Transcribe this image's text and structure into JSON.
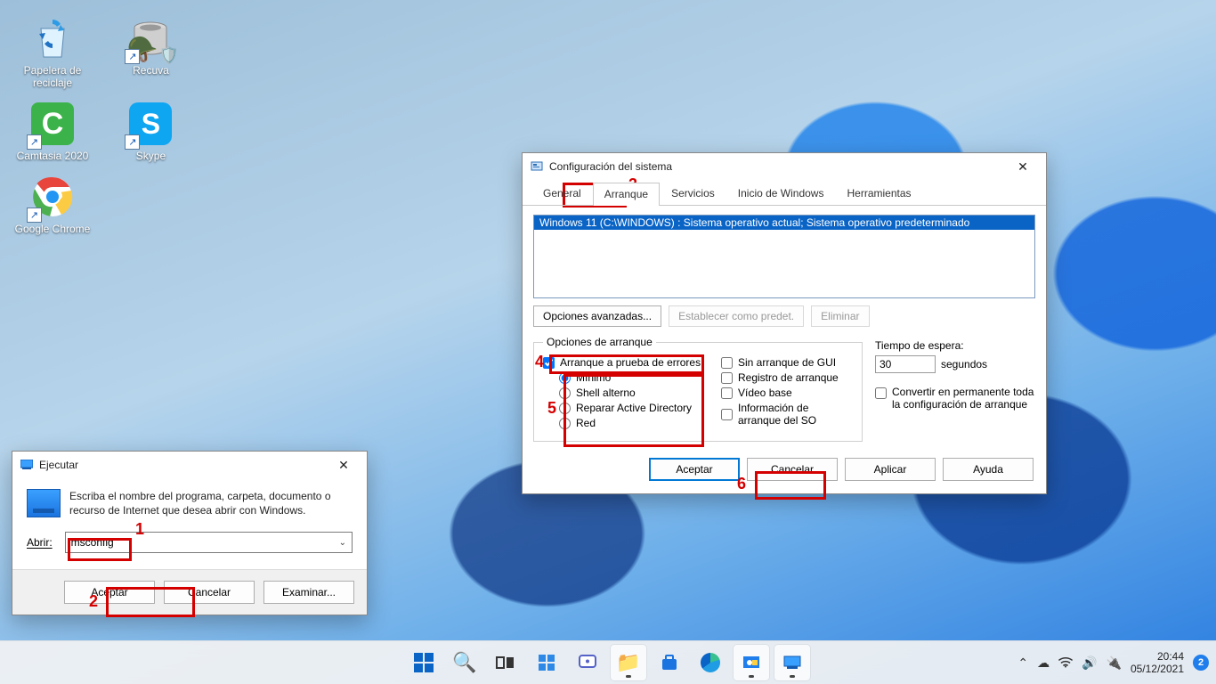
{
  "desktop": {
    "icons": [
      {
        "name": "Papelera de reciclaje",
        "glyph": "recycle-bin"
      },
      {
        "name": "Recuva",
        "glyph": "recuva",
        "shortcut": true,
        "shield": true
      },
      {
        "name": "Camtasia 2020",
        "glyph": "camtasia",
        "shortcut": true
      },
      {
        "name": "Skype",
        "glyph": "skype",
        "shortcut": true
      },
      {
        "name": "Google Chrome",
        "glyph": "chrome",
        "shortcut": true
      }
    ]
  },
  "run_dialog": {
    "title": "Ejecutar",
    "description": "Escriba el nombre del programa, carpeta, documento o recurso de Internet que desea abrir con Windows.",
    "open_label": "Abrir:",
    "open_value": "msconfig",
    "buttons": {
      "ok": "Aceptar",
      "cancel": "Cancelar",
      "browse": "Examinar..."
    }
  },
  "msconfig": {
    "title": "Configuración del sistema",
    "tabs": {
      "general": "General",
      "boot": "Arranque",
      "services": "Servicios",
      "startup": "Inicio de Windows",
      "tools": "Herramientas"
    },
    "os_entry": "Windows 11 (C:\\WINDOWS) : Sistema operativo actual; Sistema operativo predeterminado",
    "btn_adv": "Opciones avanzadas...",
    "btn_setdef": "Establecer como predet.",
    "btn_delete": "Eliminar",
    "group_title": "Opciones de arranque",
    "safe_boot": "Arranque a prueba de errores",
    "radio_min": "Mínimo",
    "radio_alt": "Shell alterno",
    "radio_ad": "Reparar Active Directory",
    "radio_net": "Red",
    "chk_nogui": "Sin arranque de GUI",
    "chk_bootlog": "Registro de arranque",
    "chk_basevideo": "Vídeo base",
    "chk_osinfo": "Información de arranque del SO",
    "timeout_label": "Tiempo de espera:",
    "timeout_value": "30",
    "timeout_unit": "segundos",
    "chk_perm": "Convertir en permanente toda la configuración de arranque",
    "footer": {
      "ok": "Aceptar",
      "cancel": "Cancelar",
      "apply": "Aplicar",
      "help": "Ayuda"
    }
  },
  "annotations": {
    "n1": "1",
    "n2": "2",
    "n3": "3",
    "n4": "4",
    "n5": "5",
    "n6": "6"
  },
  "taskbar": {
    "time": "20:44",
    "date": "05/12/2021",
    "notif_count": "2"
  }
}
